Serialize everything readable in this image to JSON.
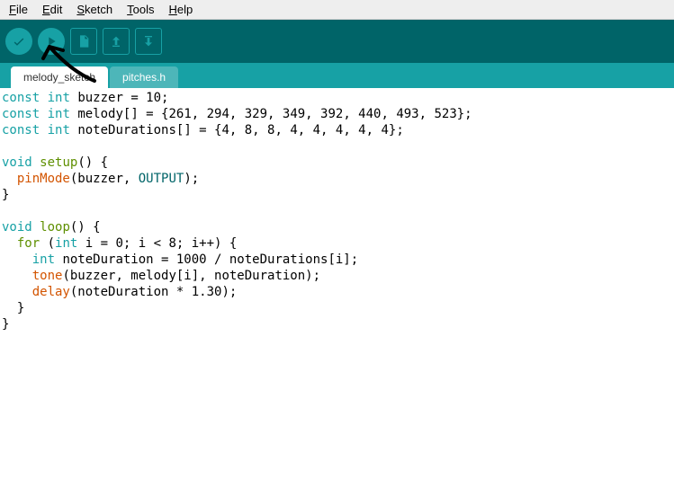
{
  "menu": {
    "file": "File",
    "edit": "Edit",
    "sketch": "Sketch",
    "tools": "Tools",
    "help": "Help"
  },
  "toolbar": {
    "verify": "verify",
    "upload": "upload",
    "new": "new",
    "open": "open",
    "save": "save"
  },
  "tabs": [
    {
      "label": "melody_sketch",
      "active": true
    },
    {
      "label": "pitches.h",
      "active": false
    }
  ],
  "code": {
    "l1_a": "const",
    "l1_b": "int",
    "l1_c": " buzzer = 10;",
    "l2_a": "const",
    "l2_b": "int",
    "l2_c": " melody[] = {261, 294, 329, 349, 392, 440, 493, 523};",
    "l3_a": "const",
    "l3_b": "int",
    "l3_c": " noteDurations[] = {4, 8, 8, 4, 4, 4, 4, 4};",
    "l5_a": "void",
    "l5_b": "setup",
    "l5_c": "() {",
    "l6_a": "  ",
    "l6_b": "pinMode",
    "l6_c": "(buzzer, ",
    "l6_d": "OUTPUT",
    "l6_e": ");",
    "l7": "}",
    "l9_a": "void",
    "l9_b": "loop",
    "l9_c": "() {",
    "l10_a": "  ",
    "l10_b": "for",
    "l10_c": " (",
    "l10_d": "int",
    "l10_e": " i = 0; i < 8; i++) {",
    "l11_a": "    ",
    "l11_b": "int",
    "l11_c": " noteDuration = 1000 / noteDurations[i];",
    "l12_a": "    ",
    "l12_b": "tone",
    "l12_c": "(buzzer, melody[i], noteDuration);",
    "l13_a": "    ",
    "l13_b": "delay",
    "l13_c": "(noteDuration * 1.30);",
    "l14": "  }",
    "l15": "}"
  }
}
